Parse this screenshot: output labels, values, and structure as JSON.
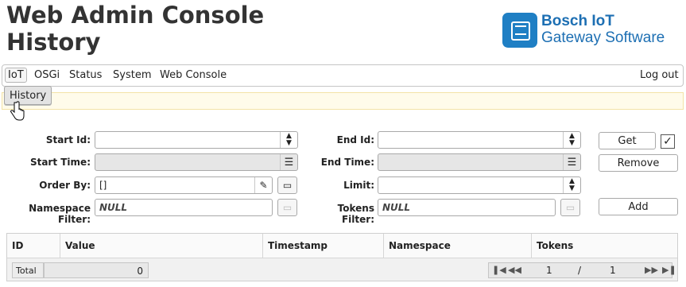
{
  "header": {
    "title_line1": "Web Admin Console",
    "title_line2": "History",
    "brand_line1": "Bosch IoT",
    "brand_line2": "Gateway Software"
  },
  "menu": {
    "items": [
      "IoT",
      "OSGi",
      "Status",
      "System",
      "Web Console"
    ],
    "logout": "Log out"
  },
  "submenu": {
    "active": "History"
  },
  "form": {
    "start_id_label": "Start Id:",
    "start_id_value": "",
    "end_id_label": "End Id:",
    "end_id_value": "",
    "start_time_label": "Start Time:",
    "start_time_value": "",
    "end_time_label": "End Time:",
    "end_time_value": "",
    "order_by_label": "Order By:",
    "order_by_value": "[]",
    "limit_label": "Limit:",
    "limit_value": "",
    "namespace_filter_label": "Namespace Filter:",
    "namespace_filter_value": "NULL",
    "tokens_filter_label": "Tokens Filter:",
    "tokens_filter_value": "NULL"
  },
  "buttons": {
    "get": "Get",
    "get_checked": true,
    "remove": "Remove",
    "add": "Add"
  },
  "table": {
    "columns": [
      "ID",
      "Value",
      "Timestamp",
      "Namespace",
      "Tokens"
    ],
    "total_label": "Total",
    "total_value": "0",
    "page_current": "1",
    "page_separator": "/",
    "page_total": "1"
  }
}
